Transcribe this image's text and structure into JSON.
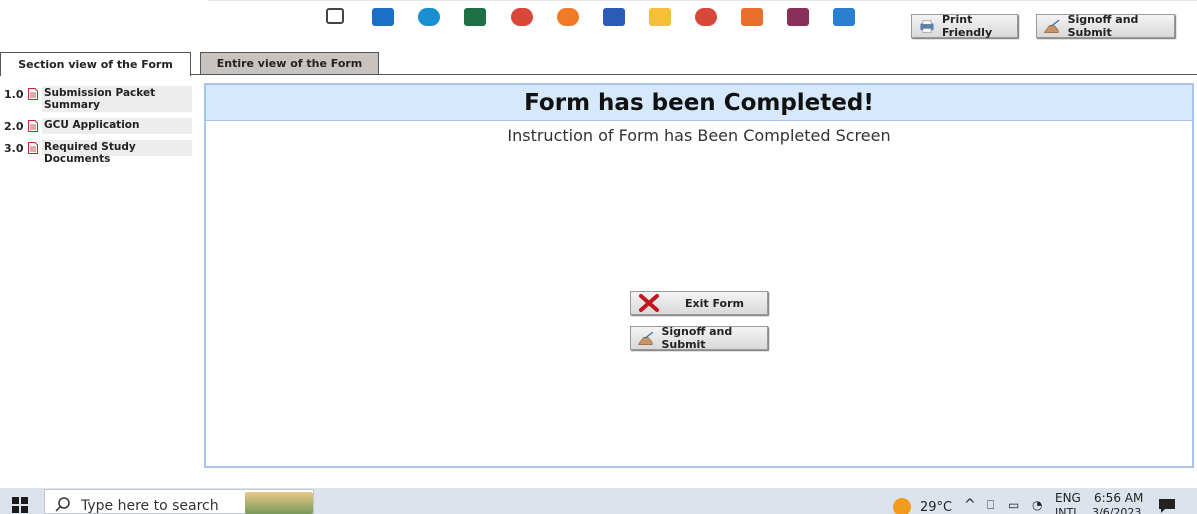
{
  "toolbar": {
    "print_label": "Print Friendly",
    "signoff_label": "Signoff and Submit"
  },
  "tabs": [
    {
      "label": "Section view of the Form",
      "active": true
    },
    {
      "label": "Entire view of the Form",
      "active": false
    }
  ],
  "sidebar": {
    "items": [
      {
        "num": "1.0",
        "label": "Submission Packet Summary"
      },
      {
        "num": "2.0",
        "label": "GCU Application"
      },
      {
        "num": "3.0",
        "label": "Required Study Documents"
      }
    ]
  },
  "main": {
    "title": "Form has been Completed!",
    "subtitle": "Instruction of Form has Been Completed Screen",
    "exit_label": "Exit Form",
    "signoff_label": "Signoff and Submit"
  },
  "taskbar": {
    "search_placeholder": "Type here to search",
    "temperature": "29°C",
    "language": "ENG",
    "language_sub": "INTL",
    "time": "6:56 AM",
    "date": "3/6/2023"
  },
  "colors": {
    "panel_border": "#a9c4ec",
    "panel_header": "#d6e8fb",
    "tab_inactive": "#c9c3c0"
  }
}
